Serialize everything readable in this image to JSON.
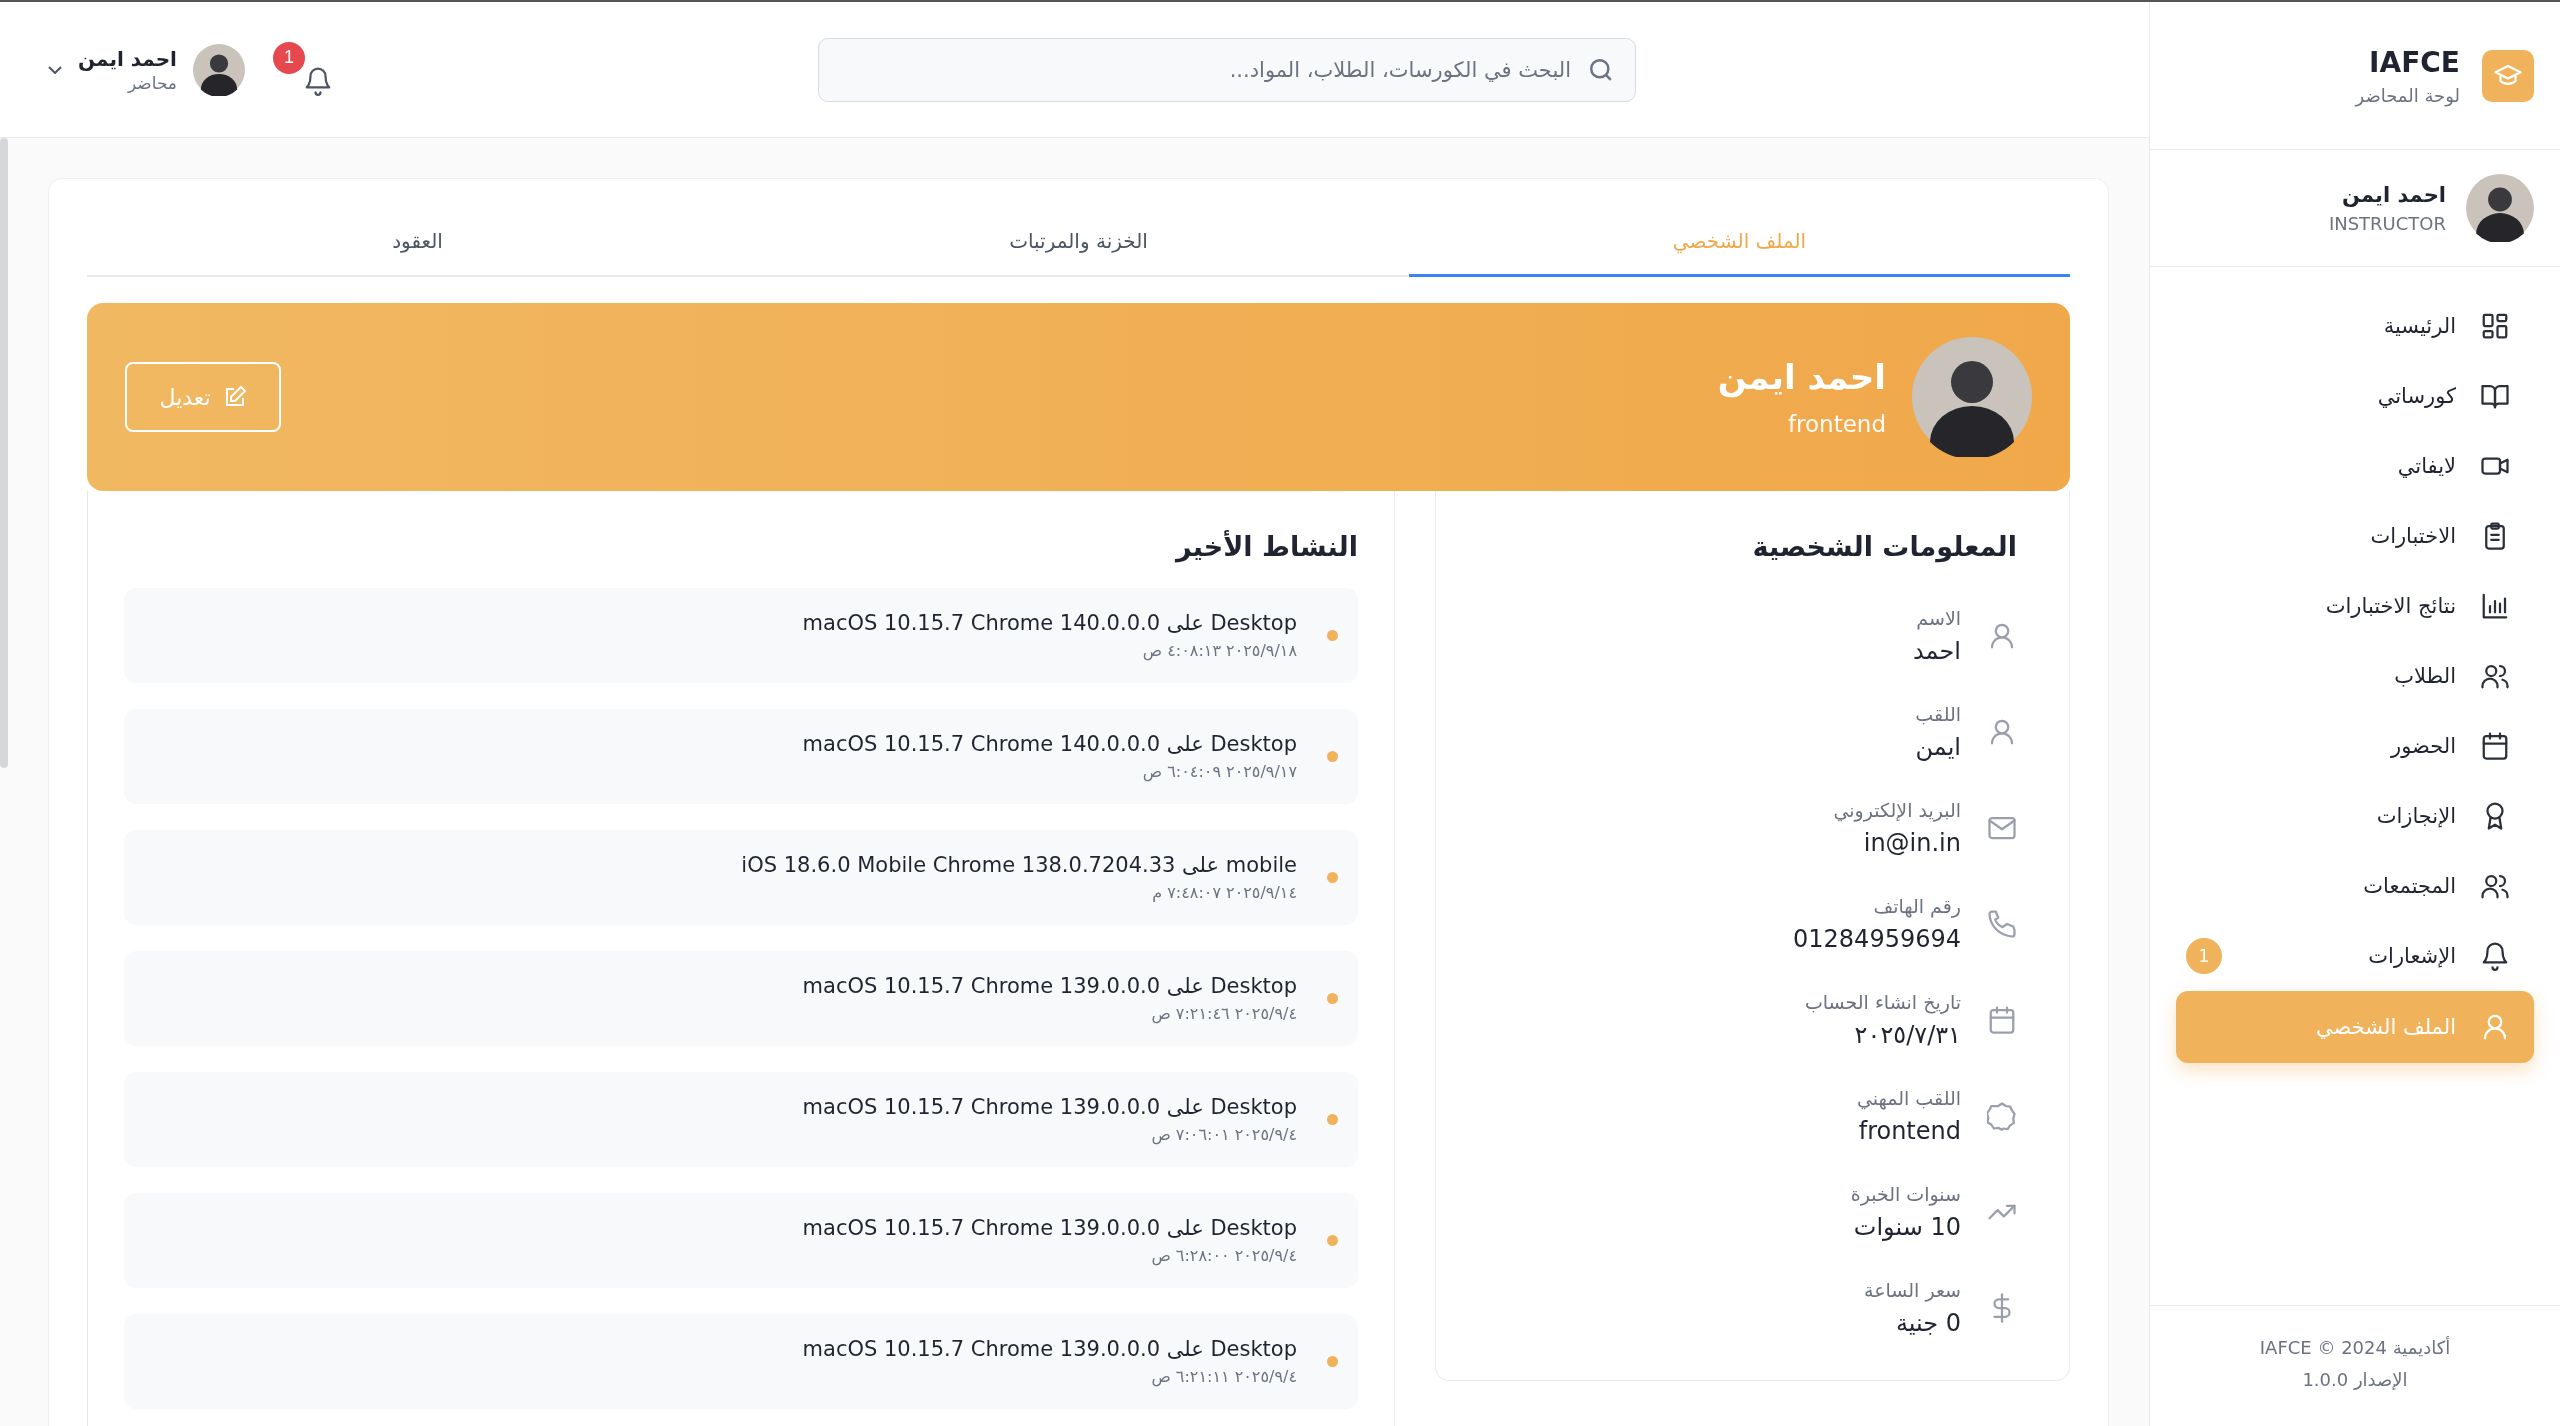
{
  "topbar": {
    "search": {
      "placeholder": "البحث في الكورسات، الطلاب، المواد..."
    },
    "notifications": {
      "count": "1"
    },
    "user": {
      "name": "احمد ايمن",
      "role": "محاضر"
    }
  },
  "tabs": [
    {
      "label": "الملف الشخصي",
      "selected": true
    },
    {
      "label": "الخزنة والمرتبات",
      "selected": false
    },
    {
      "label": "العقود",
      "selected": false
    }
  ],
  "profile_banner": {
    "name": "احمد ايمن",
    "title": "frontend",
    "edit_button": "تعديل"
  },
  "personal_info": {
    "heading": "المعلومات الشخصية",
    "fields": [
      {
        "kind": "user",
        "label": "الاسم",
        "value": "احمد"
      },
      {
        "kind": "user",
        "label": "اللقب",
        "value": "ايمن"
      },
      {
        "kind": "mail",
        "label": "البريد الإلكتروني",
        "value": "in@in.in"
      },
      {
        "kind": "phone",
        "label": "رقم الهاتف",
        "value": "01284959694"
      },
      {
        "kind": "calendar",
        "label": "تاريخ انشاء الحساب",
        "value": "٢٠٢٥/٧/٣١"
      },
      {
        "kind": "badge",
        "label": "اللقب المهني",
        "value": "frontend"
      },
      {
        "kind": "trend",
        "label": "سنوات الخبرة",
        "value": "10 سنوات"
      },
      {
        "kind": "dollar",
        "label": "سعر الساعة",
        "value": "0 جنية"
      }
    ]
  },
  "recent_activity": {
    "heading": "النشاط الأخير",
    "items": [
      {
        "device": "Desktop على macOS 10.15.7 Chrome 140.0.0.0",
        "time": "٢٠٢٥/٩/١٨ ٤:٠٨:١٣ ص"
      },
      {
        "device": "Desktop على macOS 10.15.7 Chrome 140.0.0.0",
        "time": "٢٠٢٥/٩/١٧ ٦:٠٤:٠٩ ص"
      },
      {
        "device": "mobile على iOS 18.6.0 Mobile Chrome 138.0.7204.33",
        "time": "٢٠٢٥/٩/١٤ ٧:٤٨:٠٧ م"
      },
      {
        "device": "Desktop على macOS 10.15.7 Chrome 139.0.0.0",
        "time": "٢٠٢٥/٩/٤ ٧:٢١:٤٦ ص"
      },
      {
        "device": "Desktop على macOS 10.15.7 Chrome 139.0.0.0",
        "time": "٢٠٢٥/٩/٤ ٧:٠٦:٠١ ص"
      },
      {
        "device": "Desktop على macOS 10.15.7 Chrome 139.0.0.0",
        "time": "٢٠٢٥/٩/٤ ٦:٢٨:٠٠ ص"
      },
      {
        "device": "Desktop على macOS 10.15.7 Chrome 139.0.0.0",
        "time": "٢٠٢٥/٩/٤ ٦:٢١:١١ ص"
      }
    ]
  },
  "sidebar": {
    "brand": {
      "title": "IAFCE",
      "subtitle": "لوحة المحاضر"
    },
    "user": {
      "name": "احمد ايمن",
      "role": "INSTRUCTOR"
    },
    "items": [
      {
        "kind": "grid",
        "label": "الرئيسية",
        "selected": false
      },
      {
        "kind": "book",
        "label": "كورساتي",
        "selected": false
      },
      {
        "kind": "video",
        "label": "لايفاتي",
        "selected": false
      },
      {
        "kind": "clipboard",
        "label": "الاختبارات",
        "selected": false
      },
      {
        "kind": "chart",
        "label": "نتائج الاختبارات",
        "selected": false
      },
      {
        "kind": "users",
        "label": "الطلاب",
        "selected": false
      },
      {
        "kind": "calendar",
        "label": "الحضور",
        "selected": false
      },
      {
        "kind": "award",
        "label": "الإنجازات",
        "selected": false
      },
      {
        "kind": "users",
        "label": "المجتمعات",
        "selected": false
      },
      {
        "kind": "bell",
        "label": "الإشعارات",
        "selected": false,
        "badge": "1"
      },
      {
        "kind": "user",
        "label": "الملف الشخصي",
        "selected": true
      }
    ],
    "footer": {
      "copyright": "أكاديمية IAFCE © 2024",
      "version": "الإصدار 1.0.0"
    }
  }
}
